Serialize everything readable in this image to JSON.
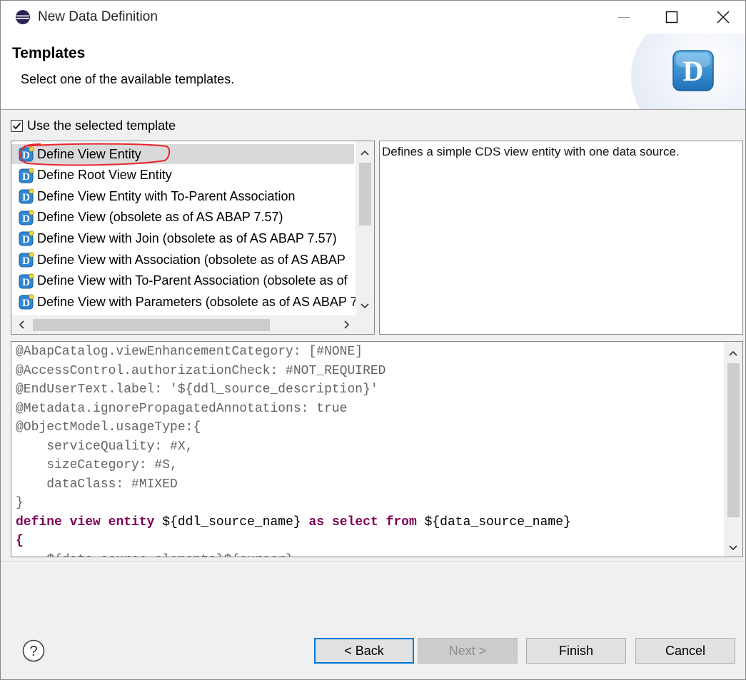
{
  "window": {
    "title": "New Data Definition"
  },
  "banner": {
    "title": "Templates",
    "description": "Select one of the available templates."
  },
  "use_template": {
    "label": "Use the selected template",
    "checked": true
  },
  "templates": [
    {
      "label": "Define View Entity",
      "selected": true
    },
    {
      "label": "Define Root View Entity"
    },
    {
      "label": "Define View Entity with To-Parent Association"
    },
    {
      "label": "Define View (obsolete as of AS ABAP 7.57)"
    },
    {
      "label": "Define View with Join (obsolete as of AS ABAP 7.57)"
    },
    {
      "label": "Define View with Association (obsolete as of AS ABAP"
    },
    {
      "label": "Define View with To-Parent Association (obsolete as of"
    },
    {
      "label": "Define View with Parameters (obsolete as of AS ABAP 7"
    }
  ],
  "template_description": "Defines a simple CDS view entity with one data source.",
  "code_lines": [
    "@AbapCatalog.viewEnhancementCategory: [#NONE]",
    "@AccessControl.authorizationCheck: #NOT_REQUIRED",
    "@EndUserText.label: '${ddl_source_description}'",
    "@Metadata.ignorePropagatedAnnotations: true",
    "@ObjectModel.usageType:{",
    "    serviceQuality: #X,",
    "    sizeCategory: #S,",
    "    dataClass: #MIXED",
    "}",
    "define view entity ${ddl_source_name} as select from ${data_source_name}",
    "{",
    "    ${data_source_elements}${cursor}"
  ],
  "buttons": {
    "back": "< Back",
    "next": "Next >",
    "finish": "Finish",
    "cancel": "Cancel"
  },
  "colors": {
    "annotation": "#646464",
    "keyword": "#7f0055",
    "selection": "#d9d9d9",
    "default_button_border": "#0078d7",
    "highlight_ellipse": "#e8262d"
  }
}
